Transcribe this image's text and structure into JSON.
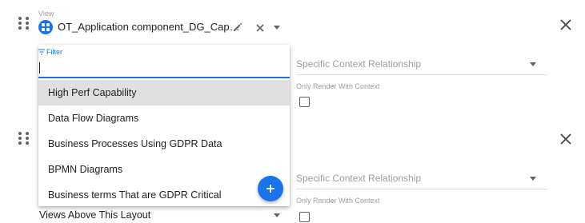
{
  "panel1": {
    "view_label": "View",
    "view_value": "OT_Application component_DG_Capability",
    "context_placeholder": "Specific Context Relationship",
    "only_render_label": "Only Render With Context"
  },
  "panel2": {
    "context_placeholder": "Specific Context Relationship",
    "only_render_label": "Only Render With Context",
    "views_above_value": "Views Above This Layout"
  },
  "dropdown": {
    "filter_label": "Filter",
    "filter_value": "",
    "options": [
      {
        "label": "High Perf Capability",
        "active": true
      },
      {
        "label": "Data Flow Diagrams",
        "active": false
      },
      {
        "label": "Business Processes Using GDPR Data",
        "active": false
      },
      {
        "label": "BPMN Diagrams",
        "active": false
      },
      {
        "label": "Business terms That are GDPR Critical",
        "active": false
      }
    ]
  },
  "icons": {
    "drag": "drag-handle-icon",
    "close": "close-icon",
    "clear": "clear-icon",
    "edit": "edit-icon",
    "view": "view-grid-icon",
    "add": "add-icon",
    "filter": "filter-icon",
    "dropdown": "chevron-down-icon"
  },
  "colors": {
    "accent": "#1a73e8",
    "highlight": "#e0e0e0"
  }
}
